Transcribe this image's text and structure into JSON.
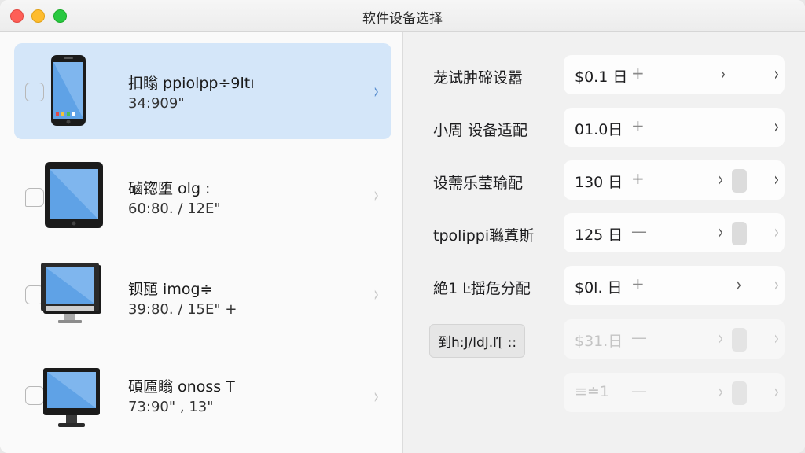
{
  "window": {
    "title": "软件设备选择"
  },
  "devices": [
    {
      "name": "扣瞈 ppiolpp÷9ltı",
      "spec": "34:909\""
    },
    {
      "name": "磠锪堕 olg :",
      "spec": "60:80. / 12E\""
    },
    {
      "name": "钡瓸 imog≑",
      "spec": "39:80. / 15E\" +"
    },
    {
      "name": "碩匾瞈 onoss T",
      "spec": "73:90\" , 13\""
    }
  ],
  "settings": [
    {
      "label": "茏试肿碲设嚣",
      "value": "$0.1 日",
      "op": "+"
    },
    {
      "label": "小周 设备适配",
      "value": "01.0日",
      "op": "+"
    },
    {
      "label": "设薷乐莹瑜配",
      "value": "130 日",
      "op": "+"
    },
    {
      "label": "tpolippi䏈蒖斯",
      "value": "125 日",
      "op": "—"
    },
    {
      "label": "絶1 Ŀ揺危分配",
      "value": "$0l. 日",
      "op": "+"
    },
    {
      "label": "到h:J/ldJ.ľ[ ::",
      "value": "$31.日",
      "op": "—"
    },
    {
      "label": "",
      "value": "≡≐1",
      "op": "—"
    }
  ]
}
